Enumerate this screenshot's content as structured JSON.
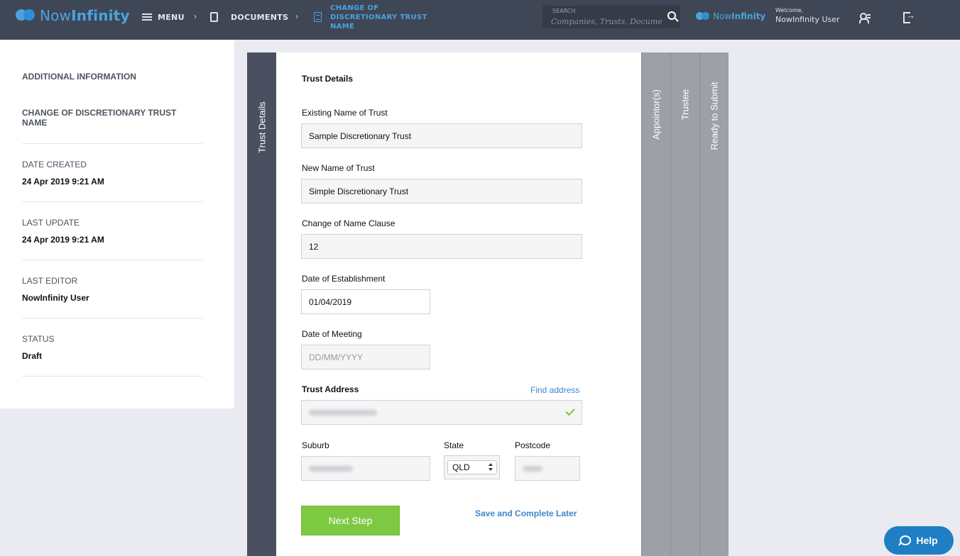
{
  "app": {
    "logo_text_light": "Now",
    "logo_text_bold": "Infinity",
    "brand_small_light": "Now",
    "brand_small_bold": "Infinity"
  },
  "nav": {
    "menu_label": "MENU",
    "documents_label": "DOCUMENTS",
    "separator": "›",
    "current_doc": "CHANGE OF DISCRETIONARY TRUST NAME"
  },
  "search": {
    "label": "SEARCH",
    "placeholder": "Companies, Trusts, Documents"
  },
  "user": {
    "welcome": "Welcome,",
    "name": "NowInfinity User"
  },
  "info_panel": {
    "title": "ADDITIONAL INFORMATION",
    "document_name": "CHANGE OF DISCRETIONARY TRUST NAME",
    "date_created_label": "DATE CREATED",
    "date_created": "24 Apr 2019 9:21 AM",
    "last_update_label": "LAST UPDATE",
    "last_update": "24 Apr 2019 9:21 AM",
    "last_editor_label": "LAST EDITOR",
    "last_editor": "NowInfinity User",
    "status_label": "STATUS",
    "status": "Draft"
  },
  "steps": {
    "active": "Trust Details",
    "appointors": "Appointor(s)",
    "trustee": "Trustee",
    "ready": "Ready to Submit"
  },
  "form": {
    "heading": "Trust Details",
    "existing_name_label": "Existing Name of Trust",
    "existing_name_value": "Sample Discretionary Trust",
    "new_name_label": "New Name of Trust",
    "new_name_value": "Simple Discretionary Trust",
    "clause_label": "Change of Name Clause",
    "clause_value": "12",
    "establishment_label": "Date of Establishment",
    "establishment_value": "01/04/2019",
    "meeting_label": "Date of Meeting",
    "meeting_placeholder": "DD/MM/YYYY",
    "address_label": "Trust Address",
    "find_address": "Find address",
    "suburb_label": "Suburb",
    "state_label": "State",
    "state_value": "QLD",
    "postcode_label": "Postcode",
    "next_button": "Next Step",
    "save_later": "Save and Complete Later"
  },
  "help": {
    "label": "Help"
  },
  "colors": {
    "topbar": "#3f4756",
    "accent": "#4aa3df",
    "link": "#3c87c8",
    "next_button": "#7ec942",
    "help_button": "#1f7ec4"
  }
}
